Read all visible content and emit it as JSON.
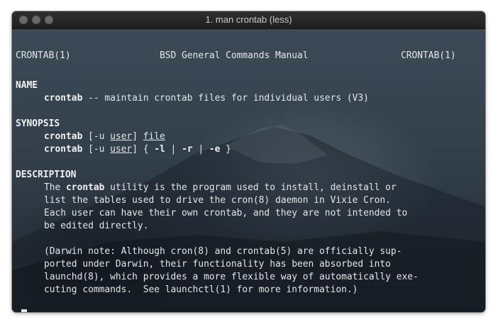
{
  "window": {
    "title": "1. man crontab (less)"
  },
  "header": {
    "left": "CRONTAB(1)",
    "center": "BSD General Commands Manual",
    "right": "CRONTAB(1)"
  },
  "name_section": {
    "heading": "NAME",
    "command": "crontab",
    "description": " -- maintain crontab files for individual users (V3)"
  },
  "synopsis": {
    "heading": "SYNOPSIS",
    "line1": {
      "cmd": "crontab",
      "opt_open": " [-u ",
      "user": "user",
      "opt_close": "] ",
      "file": "file"
    },
    "line2": {
      "cmd": "crontab",
      "opt_open": " [-u ",
      "user": "user",
      "opt_close": "] { ",
      "flag_l": "-l",
      "sep1": " | ",
      "flag_r": "-r",
      "sep2": " | ",
      "flag_e": "-e",
      "end": " }"
    }
  },
  "description": {
    "heading": "DESCRIPTION",
    "p1_l1_pre": "The ",
    "p1_l1_cmd": "crontab",
    "p1_l1_post": " utility is the program used to install, deinstall or",
    "p1_l2": "list the tables used to drive the cron(8) daemon in Vixie Cron.",
    "p1_l3": "Each user can have their own crontab, and they are not intended to",
    "p1_l4": "be edited directly.",
    "p2_l1": "(Darwin note: Although cron(8) and crontab(5) are officially sup-",
    "p2_l2": "ported under Darwin, their functionality has been absorbed into",
    "p2_l3": "launchd(8), which provides a more flexible way of automatically exe-",
    "p2_l4": "cuting commands.  See launchctl(1) for more information.)"
  },
  "prompt": {
    "symbol": ":"
  }
}
